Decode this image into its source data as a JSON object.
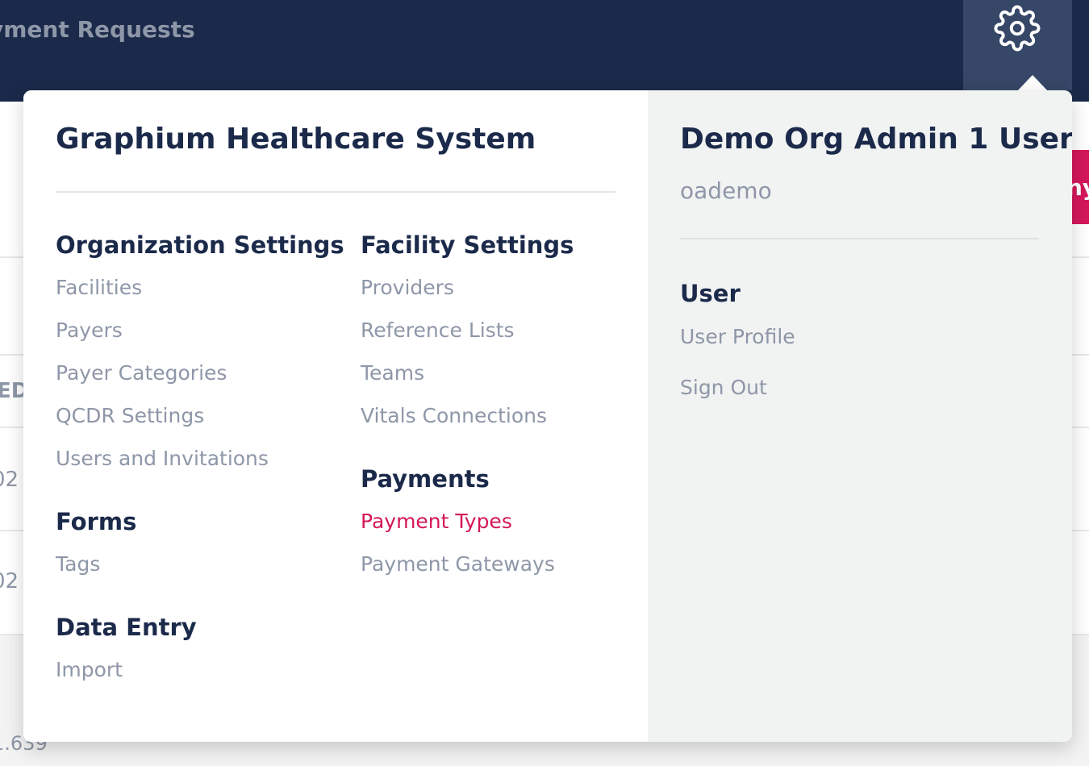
{
  "header": {
    "title": "yment Requests",
    "settings_icon": "gear-icon"
  },
  "background": {
    "partial_texts": [
      "ED",
      "02",
      "02"
    ],
    "button_partial": "ny",
    "footer_text": "1.639"
  },
  "org_menu": {
    "title": "Graphium Healthcare System",
    "sections": [
      {
        "heading": "Organization Settings",
        "items": [
          "Facilities",
          "Payers",
          "Payer Categories",
          "QCDR Settings",
          "Users and Invitations"
        ]
      },
      {
        "heading": "Forms",
        "items": [
          "Tags"
        ]
      },
      {
        "heading": "Data Entry",
        "items": [
          "Import"
        ]
      },
      {
        "heading": "Facility Settings",
        "items": [
          "Providers",
          "Reference Lists",
          "Teams",
          "Vitals Connections"
        ]
      },
      {
        "heading": "Payments",
        "items": [
          "Payment Types",
          "Payment Gateways"
        ],
        "active_item": "Payment Types"
      }
    ]
  },
  "user_menu": {
    "name": "Demo Org Admin 1 User",
    "username": "oademo",
    "section_heading": "User",
    "links": [
      "User Profile",
      "Sign Out"
    ]
  },
  "colors": {
    "navy": "#1b2a4a",
    "muted": "#8e97a8",
    "accent": "#d41759",
    "panel_gray": "#f1f2f2"
  }
}
